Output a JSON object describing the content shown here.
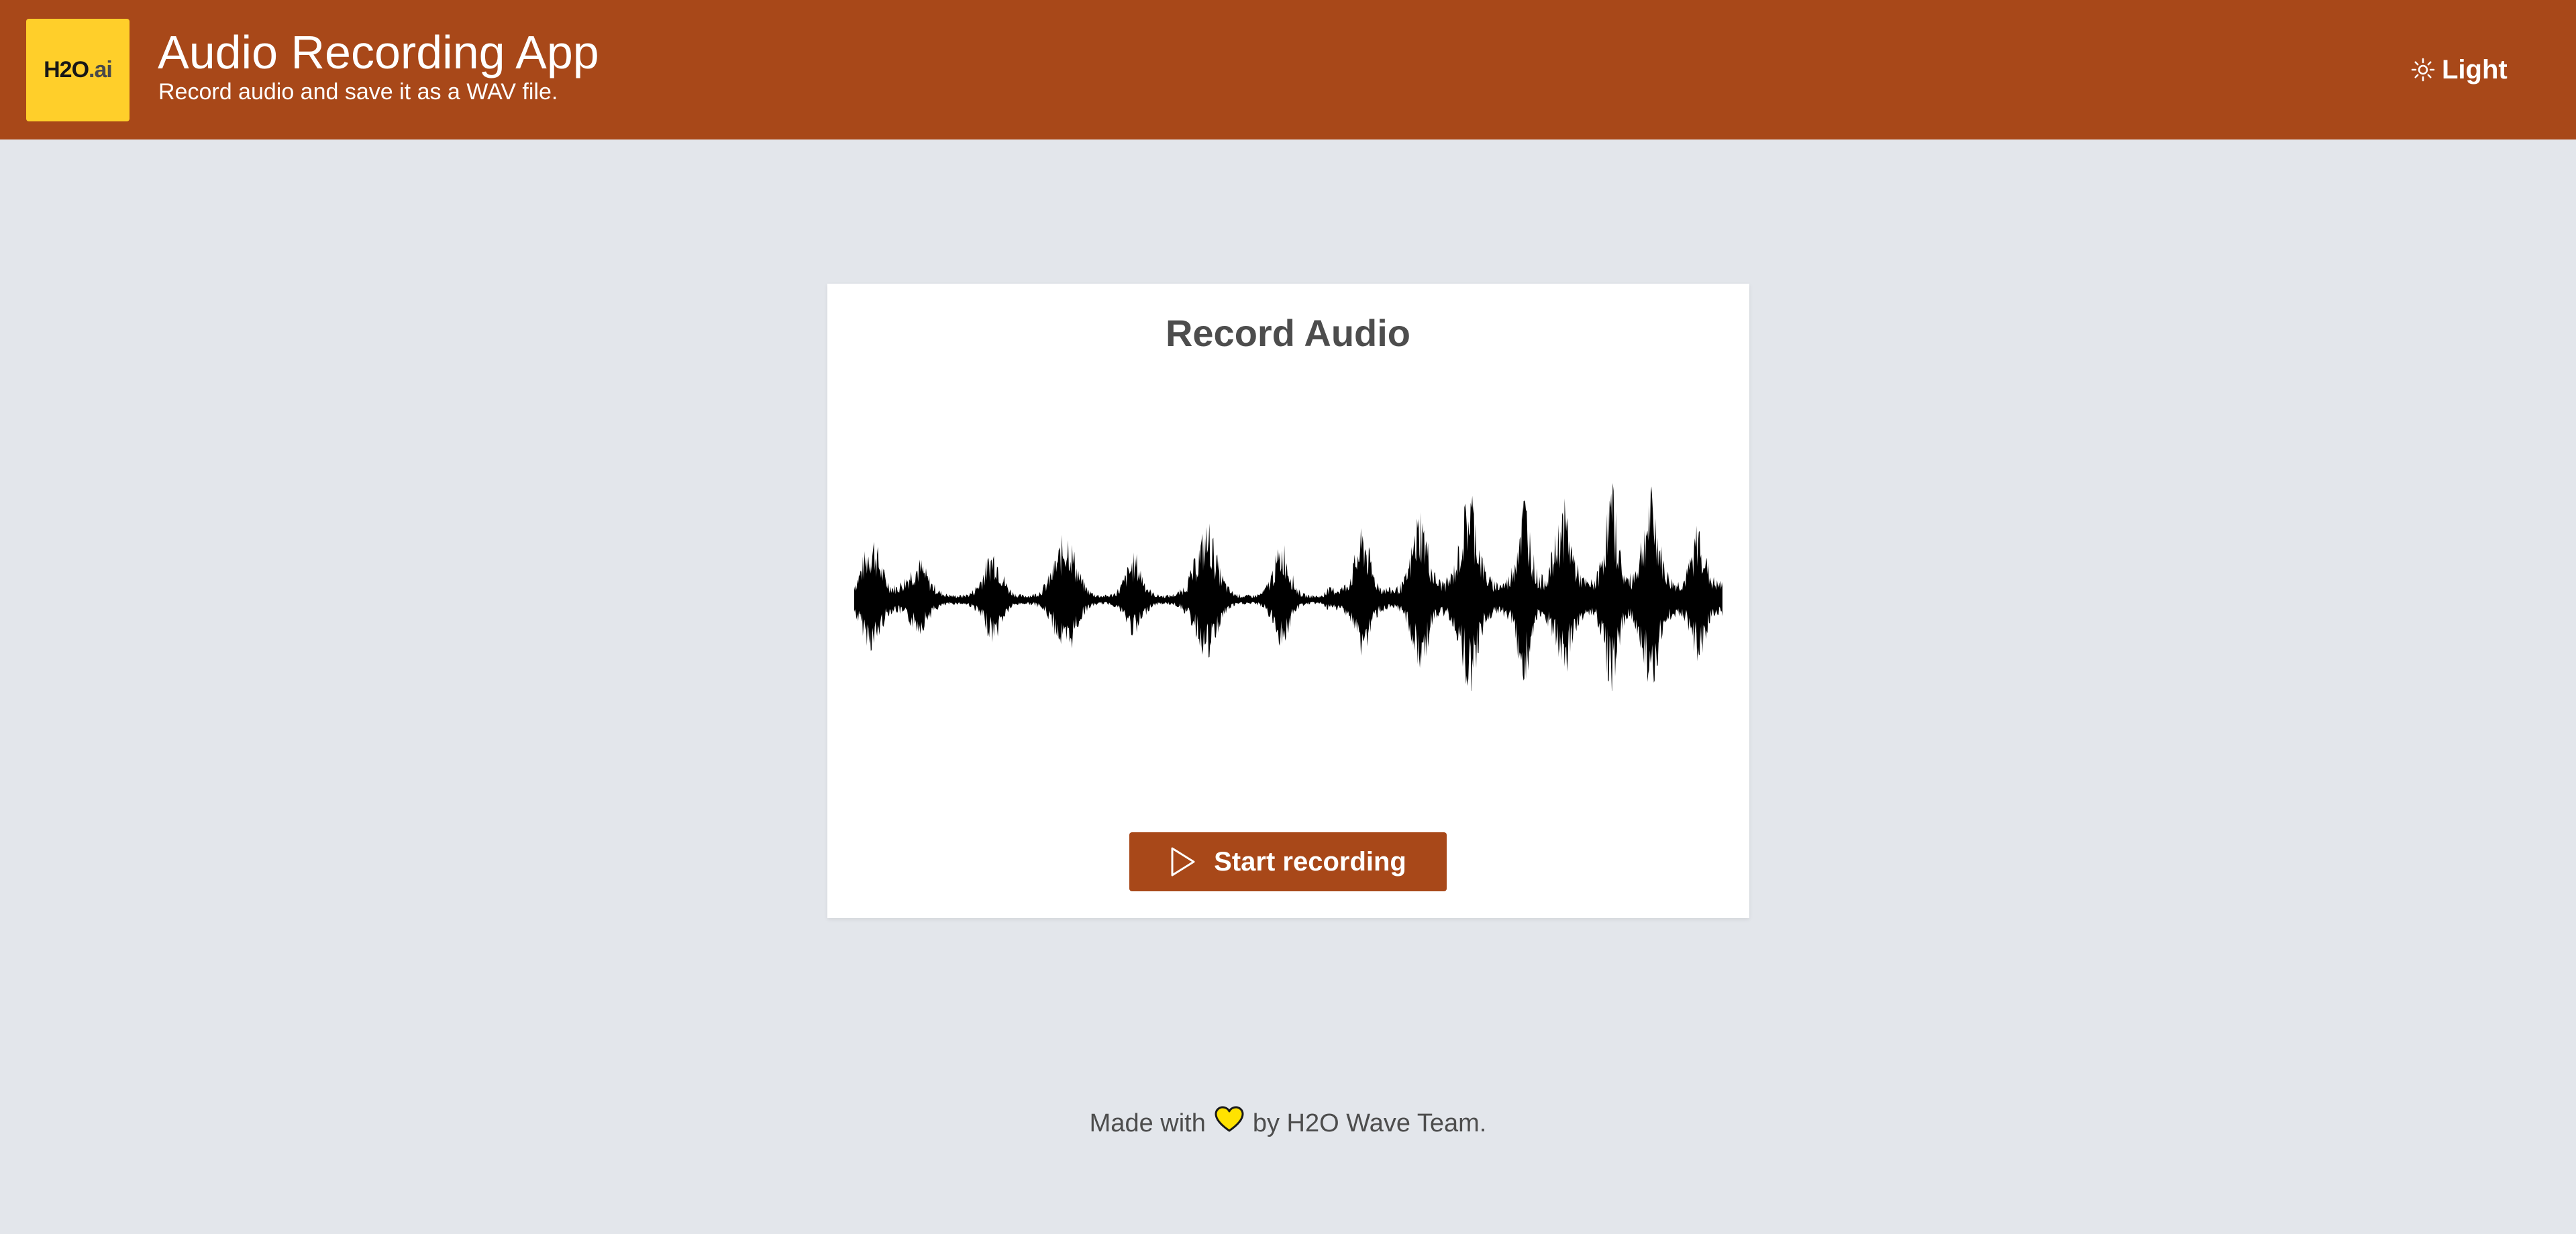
{
  "header": {
    "logo_main": "H2O",
    "logo_sub": ".ai",
    "title": "Audio Recording App",
    "subtitle": "Record audio and save it as a WAV file.",
    "theme_toggle": {
      "icon": "sun-icon",
      "label": "Light"
    }
  },
  "card": {
    "title": "Record Audio",
    "waveform_icon": "audio-waveform",
    "record_button": {
      "icon": "play-icon",
      "label": "Start recording"
    }
  },
  "footer": {
    "before": "Made with",
    "heart_icon": "heart-icon",
    "after": "by H2O Wave Team."
  },
  "colors": {
    "header_bg": "#a84819",
    "page_bg": "#e3e6eb",
    "logo_bg": "#ffcf2a",
    "button_bg": "#a84819",
    "heart": "#ffe200"
  }
}
